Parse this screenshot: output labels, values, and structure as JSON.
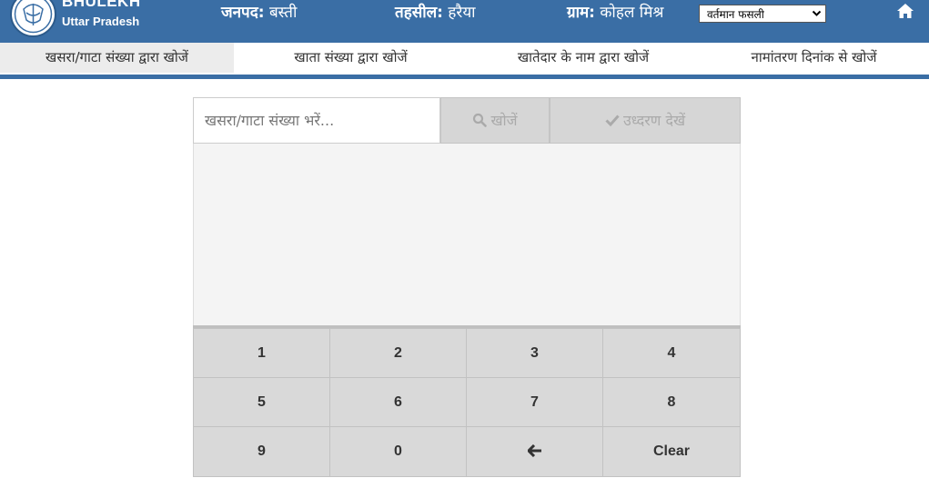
{
  "header": {
    "brand_name": "BHULEKH",
    "brand_state": "Uttar Pradesh",
    "janpad_label": "जनपद:",
    "janpad_value": "बस्ती",
    "tehsil_label": "तहसील:",
    "tehsil_value": "हरैया",
    "gram_label": "ग्राम:",
    "gram_value": "कोहल मिश्र",
    "fasli_selected": "वर्तमान फसली",
    "accent_color": "#3a6ea5"
  },
  "tabs": [
    {
      "label": "खसरा/गाटा संख्या द्वारा खोजें",
      "active": true
    },
    {
      "label": "खाता संख्या द्वारा खोजें",
      "active": false
    },
    {
      "label": "खातेदार के नाम द्वारा खोजें",
      "active": false
    },
    {
      "label": "नामांतरण दिनांक से खोजें",
      "active": false
    }
  ],
  "search": {
    "placeholder": "खसरा/गाटा संख्या भरें...",
    "search_button": "खोजें",
    "view_button": "उध्दरण देखें",
    "search_icon": "search-icon",
    "view_icon": "check-icon"
  },
  "keypad": {
    "keys": [
      "1",
      "2",
      "3",
      "4",
      "5",
      "6",
      "7",
      "8",
      "9",
      "0",
      "backspace",
      "Clear"
    ]
  }
}
